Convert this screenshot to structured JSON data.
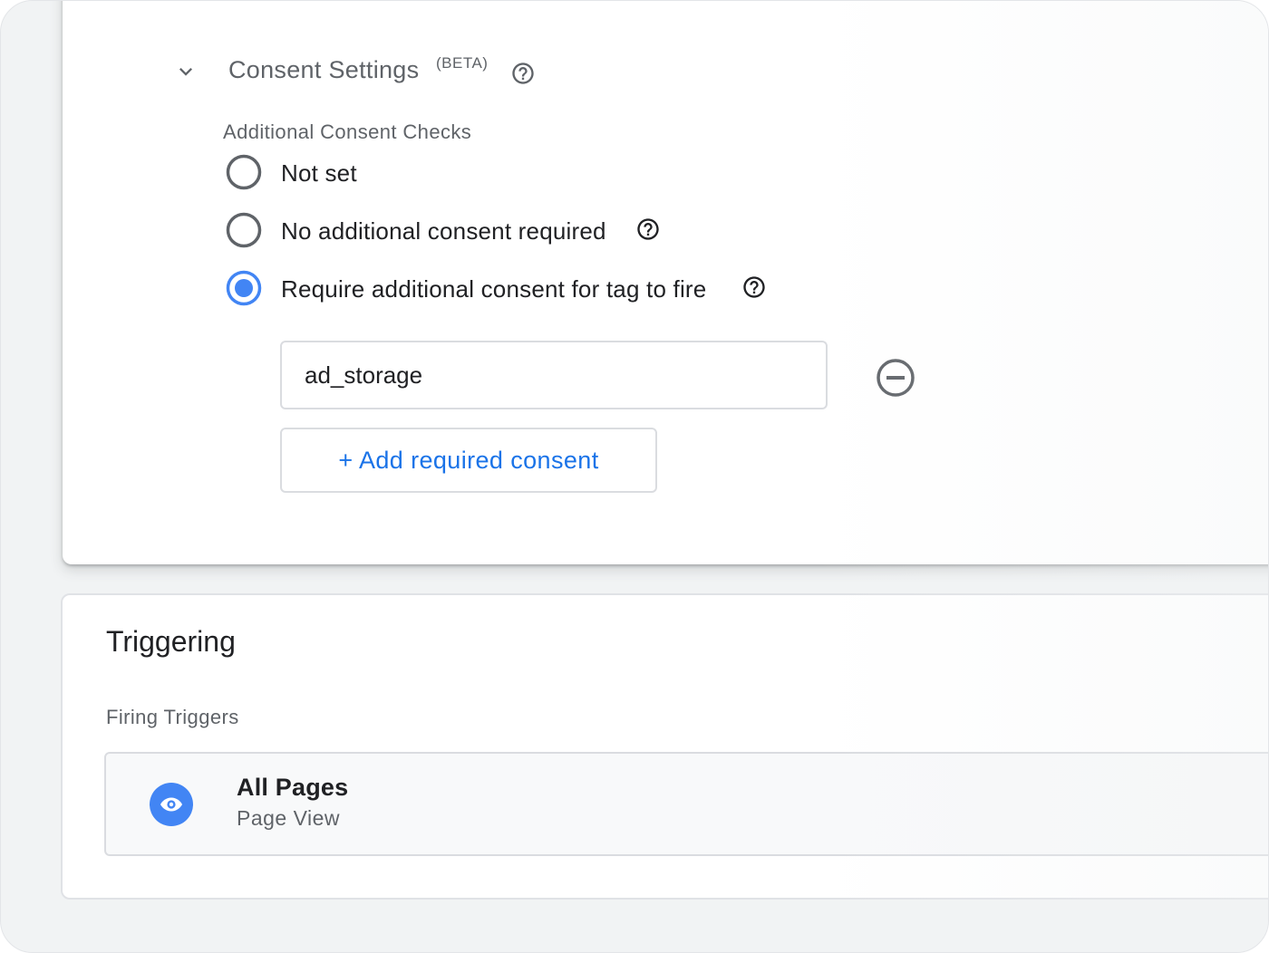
{
  "consent_settings": {
    "title": "Consent Settings",
    "badge": "(BETA)",
    "expand_icon": "chevron-down-icon",
    "help_icon": "help-circle-icon",
    "group_label": "Additional Consent Checks",
    "options": [
      {
        "label": "Not set",
        "selected": false,
        "has_help": false
      },
      {
        "label": "No additional consent required",
        "selected": false,
        "has_help": true
      },
      {
        "label": "Require additional consent for tag to fire",
        "selected": true,
        "has_help": true
      }
    ],
    "required_consent_value": "ad_storage",
    "remove_icon": "remove-circle-icon",
    "add_button_label": "+ Add required consent"
  },
  "triggering": {
    "title": "Triggering",
    "firing_label": "Firing Triggers",
    "trigger": {
      "name": "All Pages",
      "type": "Page View",
      "icon": "eye-icon"
    }
  },
  "colors": {
    "accent": "#1a73e8",
    "radio_selected": "#4285f4",
    "radio_unselected": "#5f6368",
    "text_primary": "#202124",
    "text_secondary": "#5f6368",
    "border": "#dadce0",
    "background": "#f1f3f4"
  }
}
